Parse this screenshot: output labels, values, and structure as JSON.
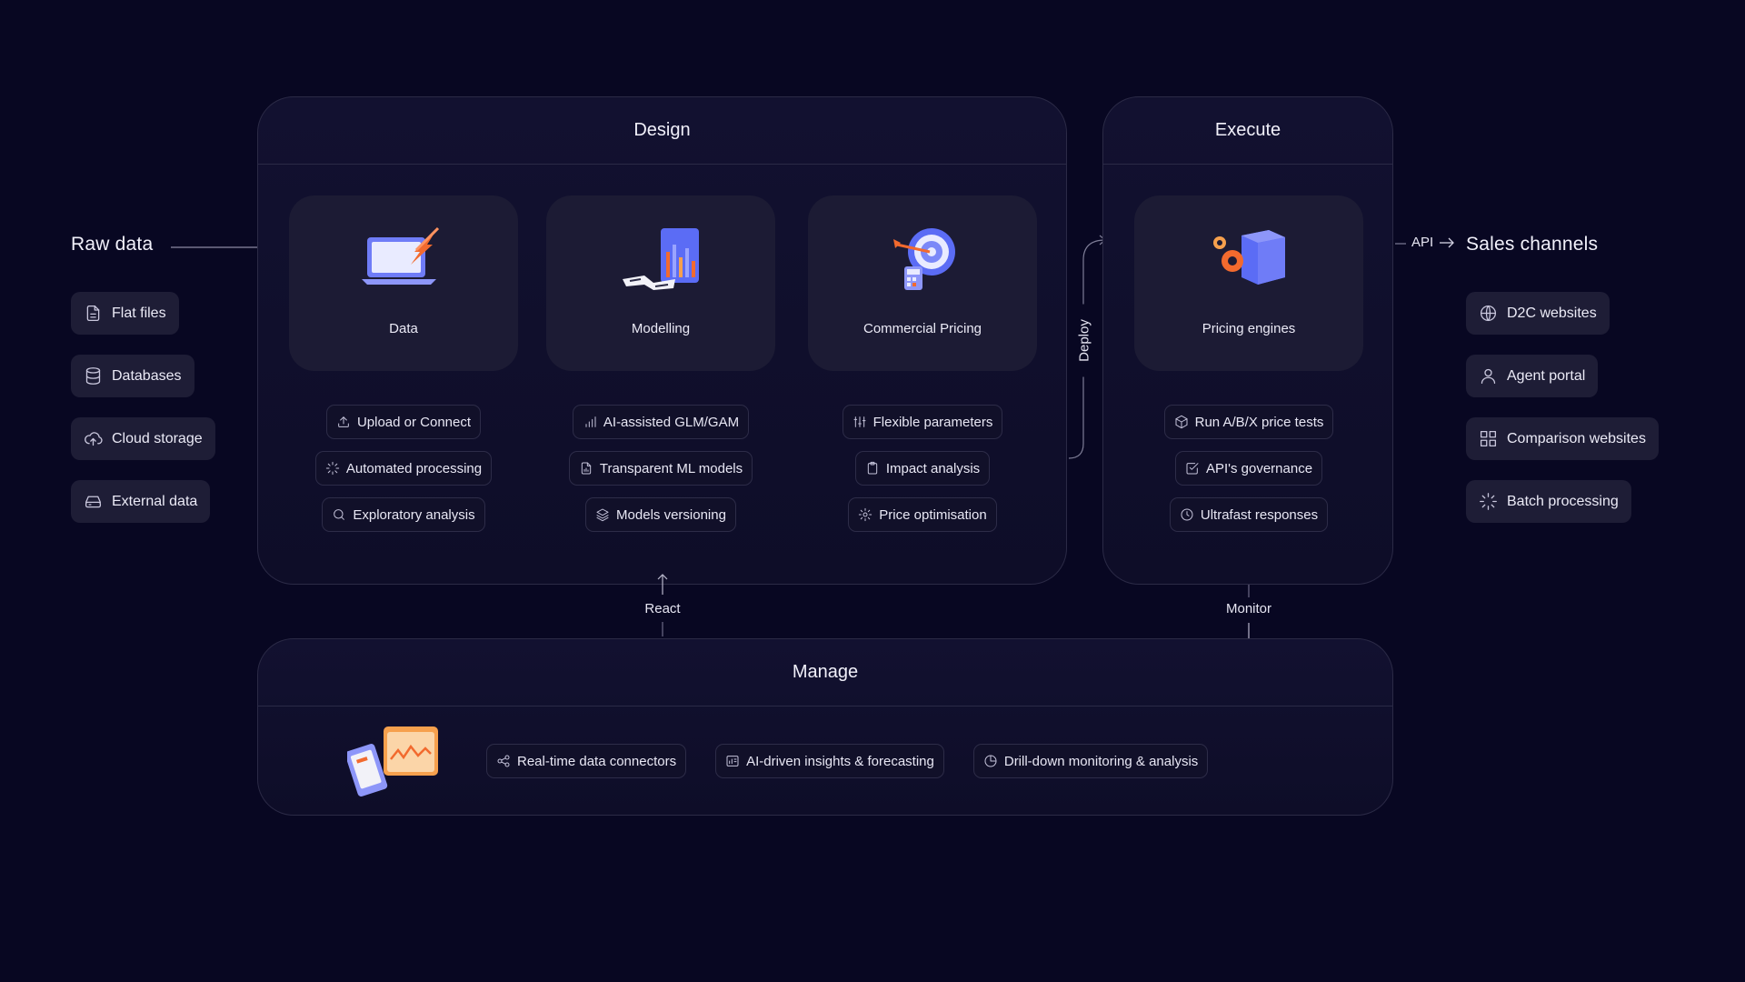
{
  "raw_data": {
    "title": "Raw data",
    "items": [
      {
        "label": "Flat files",
        "icon": "file-icon"
      },
      {
        "label": "Databases",
        "icon": "database-icon"
      },
      {
        "label": "Cloud storage",
        "icon": "cloud-upload-icon"
      },
      {
        "label": "External data",
        "icon": "drive-icon"
      }
    ]
  },
  "design": {
    "title": "Design",
    "cards": [
      {
        "label": "Data",
        "icon": "laptop-arrow-illustration"
      },
      {
        "label": "Modelling",
        "icon": "chart-tablet-illustration"
      },
      {
        "label": "Commercial Pricing",
        "icon": "target-illustration"
      }
    ],
    "features": [
      [
        {
          "label": "Upload or Connect",
          "icon": "upload-icon"
        },
        {
          "label": "Automated processing",
          "icon": "loader-icon"
        },
        {
          "label": "Exploratory analysis",
          "icon": "search-icon"
        }
      ],
      [
        {
          "label": "AI-assisted GLM/GAM",
          "icon": "bar-chart-icon"
        },
        {
          "label": "Transparent ML models",
          "icon": "file-chart-icon"
        },
        {
          "label": "Models versioning",
          "icon": "layers-icon"
        }
      ],
      [
        {
          "label": "Flexible parameters",
          "icon": "sliders-icon"
        },
        {
          "label": "Impact analysis",
          "icon": "clipboard-icon"
        },
        {
          "label": "Price optimisation",
          "icon": "gear-icon"
        }
      ]
    ]
  },
  "execute": {
    "title": "Execute",
    "card": {
      "label": "Pricing engines",
      "icon": "cube-gears-illustration"
    },
    "features": [
      {
        "label": "Run A/B/X price tests",
        "icon": "box-icon"
      },
      {
        "label": "API's governance",
        "icon": "check-square-icon"
      },
      {
        "label": "Ultrafast responses",
        "icon": "clock-icon"
      }
    ]
  },
  "manage": {
    "title": "Manage",
    "features": [
      {
        "label": "Real-time data connectors",
        "icon": "share-icon"
      },
      {
        "label": "AI-driven insights & forecasting",
        "icon": "dashboard-icon"
      },
      {
        "label": "Drill-down monitoring & analysis",
        "icon": "pie-icon"
      }
    ]
  },
  "sales_channels": {
    "title": "Sales channels",
    "items": [
      {
        "label": "D2C websites",
        "icon": "globe-icon"
      },
      {
        "label": "Agent portal",
        "icon": "user-icon"
      },
      {
        "label": "Comparison websites",
        "icon": "grid-icon"
      },
      {
        "label": "Batch processing",
        "icon": "loader-icon"
      }
    ]
  },
  "connectors": {
    "deploy": "Deploy",
    "api": "API",
    "react": "React",
    "monitor": "Monitor"
  },
  "colors": {
    "background": "#080722",
    "panel_border": "#2b2a46",
    "card": "#1c1b34",
    "accent_orange": "#f26a2e",
    "accent_blue": "#5b6cf5"
  }
}
